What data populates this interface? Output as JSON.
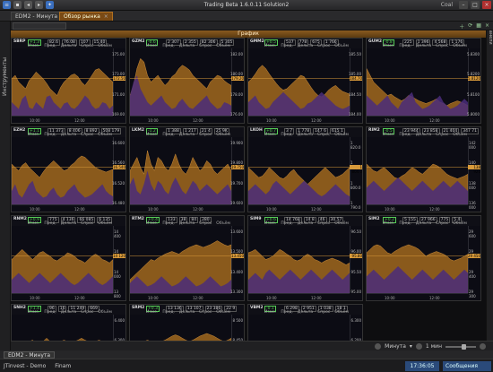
{
  "app": {
    "title": "Trading Beta 1.6.0.11 Solution2",
    "user": "Coal"
  },
  "tabs": [
    {
      "label": "EDM2 - Минута"
    },
    {
      "label": "Обзор рынка"
    }
  ],
  "strips": {
    "left": "Инструменты",
    "right": "Панели"
  },
  "section_header": "График",
  "colors": {
    "accent": "#d89a3a",
    "fill_orange": "#8a5a1c",
    "fill_purple": "#4a2d7a",
    "bg": "#0c0c14"
  },
  "panels": [
    {
      "ticker": "SBRP",
      "chg": "+1.3",
      "cells": [
        "82.6",
        "76.08",
        "107",
        "15.40"
      ],
      "yticks": [
        "175.00",
        "173.00",
        "171.00",
        "169.00"
      ],
      "cur": "172.50",
      "xticks": [
        "10:00",
        "12:00"
      ],
      "bars": [
        0.55,
        0.6,
        0.5,
        0.45,
        0.4,
        0.52,
        0.58,
        0.65,
        0.6,
        0.55,
        0.48,
        0.4,
        0.35,
        0.3,
        0.42,
        0.5,
        0.55,
        0.6,
        0.62,
        0.58,
        0.5,
        0.45,
        0.52,
        0.6,
        0.68,
        0.7,
        0.65,
        0.6,
        0.55,
        0.5
      ],
      "vol": [
        0.2,
        0.15,
        0.1,
        0.25,
        0.3,
        0.12,
        0.1,
        0.2,
        0.15,
        0.1,
        0.28,
        0.3,
        0.2,
        0.15,
        0.1,
        0.18,
        0.2,
        0.12,
        0.1,
        0.15,
        0.22,
        0.3,
        0.25,
        0.15,
        0.1,
        0.12,
        0.2,
        0.18,
        0.1,
        0.15
      ]
    },
    {
      "ticker": "GZM2",
      "chg": "-0.6",
      "cells": [
        "2 307",
        "2 355",
        "82 306",
        "5 305"
      ],
      "yticks": [
        "182.00",
        "180.00",
        "178.00",
        "176.00"
      ],
      "cur": "179.20",
      "xticks": [
        "10:00",
        "12:00"
      ],
      "bars": [
        0.3,
        0.45,
        0.7,
        0.85,
        0.8,
        0.6,
        0.5,
        0.55,
        0.6,
        0.52,
        0.45,
        0.5,
        0.58,
        0.62,
        0.7,
        0.75,
        0.72,
        0.68,
        0.6,
        0.55,
        0.5,
        0.45,
        0.4,
        0.5,
        0.55,
        0.6,
        0.58,
        0.52,
        0.48,
        0.45
      ],
      "vol": [
        0.3,
        0.5,
        0.6,
        0.4,
        0.3,
        0.2,
        0.15,
        0.2,
        0.25,
        0.3,
        0.2,
        0.15,
        0.1,
        0.12,
        0.2,
        0.25,
        0.18,
        0.12,
        0.1,
        0.15,
        0.2,
        0.25,
        0.3,
        0.2,
        0.15,
        0.1,
        0.12,
        0.2,
        0.18,
        0.15
      ]
    },
    {
      "ticker": "GMM2",
      "chg": "+0.5",
      "cells": [
        "537",
        "778",
        "675",
        "1 766"
      ],
      "yticks": [
        "185.50",
        "185.00",
        "184.50",
        "184.00"
      ],
      "cur": "184.70",
      "xticks": [
        "10:00",
        "12:00"
      ],
      "bars": [
        0.5,
        0.55,
        0.62,
        0.7,
        0.75,
        0.7,
        0.62,
        0.55,
        0.48,
        0.42,
        0.38,
        0.4,
        0.45,
        0.5,
        0.55,
        0.6,
        0.58,
        0.5,
        0.42,
        0.35,
        0.3,
        0.28,
        0.32,
        0.38,
        0.42,
        0.45,
        0.4,
        0.36,
        0.34,
        0.32
      ],
      "vol": [
        0.2,
        0.25,
        0.3,
        0.2,
        0.15,
        0.1,
        0.12,
        0.2,
        0.25,
        0.3,
        0.35,
        0.3,
        0.25,
        0.2,
        0.15,
        0.1,
        0.12,
        0.18,
        0.2,
        0.25,
        0.3,
        0.35,
        0.3,
        0.25,
        0.2,
        0.15,
        0.12,
        0.1,
        0.12,
        0.15
      ]
    },
    {
      "ticker": "GUM2",
      "chg": "-0.8",
      "cells": [
        "225",
        "1 396",
        "4 568",
        "1 176"
      ],
      "yticks": [
        "5.8300",
        "5.8200",
        "5.8100",
        "5.8000"
      ],
      "cur": "5.8120",
      "xticks": [
        "10:00",
        "12:00"
      ],
      "bars": [
        0.7,
        0.6,
        0.5,
        0.45,
        0.4,
        0.35,
        0.3,
        0.32,
        0.28,
        0.25,
        0.22,
        0.25,
        0.3,
        0.28,
        0.25,
        0.22,
        0.2,
        0.18,
        0.2,
        0.22,
        0.25,
        0.2,
        0.18,
        0.15,
        0.18,
        0.2,
        0.22,
        0.2,
        0.18,
        0.15
      ],
      "vol": [
        0.3,
        0.25,
        0.2,
        0.15,
        0.2,
        0.25,
        0.3,
        0.2,
        0.15,
        0.1,
        0.2,
        0.25,
        0.3,
        0.35,
        0.2,
        0.15,
        0.1,
        0.12,
        0.15,
        0.2,
        0.25,
        0.3,
        0.2,
        0.15,
        0.1,
        0.12,
        0.15,
        0.2,
        0.25,
        0.2
      ]
    },
    {
      "ticker": "EZH2",
      "chg": "+1.1",
      "cells": [
        "11 373",
        "8 406",
        "8 892",
        "508 179"
      ],
      "yticks": [
        "16.600",
        "16.560",
        "16.520",
        "16.480"
      ],
      "cur": "16.540",
      "xticks": [
        "10:00",
        "12:00"
      ],
      "bars": [
        0.6,
        0.55,
        0.5,
        0.58,
        0.62,
        0.55,
        0.5,
        0.45,
        0.4,
        0.48,
        0.55,
        0.6,
        0.65,
        0.6,
        0.55,
        0.5,
        0.52,
        0.58,
        0.62,
        0.68,
        0.72,
        0.7,
        0.65,
        0.6,
        0.55,
        0.52,
        0.5,
        0.48,
        0.5,
        0.52
      ],
      "vol": [
        0.2,
        0.3,
        0.15,
        0.1,
        0.2,
        0.3,
        0.35,
        0.2,
        0.15,
        0.1,
        0.12,
        0.2,
        0.25,
        0.15,
        0.1,
        0.12,
        0.2,
        0.25,
        0.3,
        0.2,
        0.15,
        0.1,
        0.12,
        0.15,
        0.2,
        0.25,
        0.3,
        0.2,
        0.15,
        0.12
      ]
    },
    {
      "ticker": "LKM2",
      "chg": "-1.2",
      "cells": [
        "1 388",
        "1 217",
        "21 4",
        "25 9K"
      ],
      "yticks": [
        "19.900",
        "19.800",
        "19.700",
        "19.600"
      ],
      "cur": "19.750",
      "xticks": [
        "10:00",
        "12:00"
      ],
      "bars": [
        0.5,
        0.6,
        0.7,
        0.55,
        0.45,
        0.8,
        0.6,
        0.5,
        0.7,
        0.65,
        0.55,
        0.5,
        0.6,
        0.75,
        0.6,
        0.5,
        0.45,
        0.55,
        0.7,
        0.6,
        0.5,
        0.55,
        0.65,
        0.6,
        0.5,
        0.45,
        0.5,
        0.55,
        0.6,
        0.5
      ],
      "vol": [
        0.3,
        0.4,
        0.2,
        0.15,
        0.3,
        0.5,
        0.3,
        0.2,
        0.35,
        0.3,
        0.2,
        0.15,
        0.3,
        0.4,
        0.3,
        0.2,
        0.15,
        0.25,
        0.35,
        0.3,
        0.2,
        0.25,
        0.3,
        0.25,
        0.2,
        0.15,
        0.2,
        0.25,
        0.3,
        0.2
      ]
    },
    {
      "ticker": "LKOH",
      "chg": "+0.7",
      "cells": [
        "3 7",
        "1 778",
        "147 6",
        "615 1"
      ],
      "yticks": [
        "1 820.0",
        "1 810.0",
        "1 800.0",
        "1 790.0"
      ],
      "cur": "1 804.0",
      "xticks": [
        "10:00",
        "12:00"
      ],
      "bars": [
        0.55,
        0.5,
        0.45,
        0.4,
        0.42,
        0.48,
        0.55,
        0.5,
        0.45,
        0.4,
        0.38,
        0.42,
        0.48,
        0.52,
        0.45,
        0.4,
        0.35,
        0.3,
        0.35,
        0.4,
        0.45,
        0.5,
        0.55,
        0.5,
        0.45,
        0.4,
        0.42,
        0.45,
        0.5,
        0.55
      ],
      "vol": [
        0.2,
        0.25,
        0.3,
        0.25,
        0.2,
        0.15,
        0.2,
        0.3,
        0.35,
        0.3,
        0.25,
        0.2,
        0.15,
        0.2,
        0.25,
        0.3,
        0.35,
        0.3,
        0.25,
        0.2,
        0.15,
        0.12,
        0.15,
        0.2,
        0.25,
        0.3,
        0.25,
        0.2,
        0.15,
        0.12
      ]
    },
    {
      "ticker": "RIM2",
      "chg": "-0.5",
      "cells": [
        "23 944",
        "23 858",
        "21 404",
        "347 71"
      ],
      "yticks": [
        "142 000",
        "140 000",
        "138 000",
        "136 000"
      ],
      "cur": "138 920",
      "xticks": [
        "10:00",
        "12:00"
      ],
      "bars": [
        0.6,
        0.55,
        0.5,
        0.48,
        0.52,
        0.55,
        0.5,
        0.45,
        0.4,
        0.38,
        0.42,
        0.45,
        0.5,
        0.55,
        0.52,
        0.48,
        0.45,
        0.5,
        0.55,
        0.6,
        0.58,
        0.55,
        0.5,
        0.45,
        0.42,
        0.4,
        0.38,
        0.4,
        0.42,
        0.45
      ],
      "vol": [
        0.25,
        0.3,
        0.35,
        0.3,
        0.25,
        0.2,
        0.25,
        0.3,
        0.35,
        0.4,
        0.35,
        0.3,
        0.25,
        0.2,
        0.25,
        0.3,
        0.35,
        0.3,
        0.25,
        0.2,
        0.25,
        0.3,
        0.35,
        0.3,
        0.25,
        0.3,
        0.35,
        0.3,
        0.25,
        0.2
      ]
    },
    {
      "ticker": "RNM2",
      "chg": "+0.9",
      "cells": [
        "775",
        "4 136",
        "66 085",
        "6 135"
      ],
      "yticks": [
        "14 400",
        "14 200",
        "14 000",
        "13 800"
      ],
      "cur": "14 120",
      "xticks": [
        "10:00",
        "12:00"
      ],
      "bars": [
        0.5,
        0.55,
        0.6,
        0.65,
        0.6,
        0.55,
        0.5,
        0.55,
        0.6,
        0.62,
        0.58,
        0.55,
        0.5,
        0.48,
        0.52,
        0.55,
        0.6,
        0.58,
        0.55,
        0.5,
        0.48,
        0.45,
        0.5,
        0.55,
        0.58,
        0.55,
        0.5,
        0.48,
        0.45,
        0.5
      ],
      "vol": [
        0.2,
        0.25,
        0.3,
        0.25,
        0.2,
        0.15,
        0.2,
        0.25,
        0.3,
        0.25,
        0.2,
        0.15,
        0.2,
        0.25,
        0.3,
        0.25,
        0.2,
        0.15,
        0.12,
        0.15,
        0.2,
        0.25,
        0.3,
        0.25,
        0.2,
        0.15,
        0.12,
        0.15,
        0.2,
        0.25
      ]
    },
    {
      "ticker": "RTM2",
      "chg": "+0.4",
      "cells": [
        "133",
        "38",
        "84",
        "280"
      ],
      "yticks": [
        "13.600",
        "13.500",
        "13.400",
        "13.300"
      ],
      "cur": "13.450",
      "xticks": [
        "10:00",
        "12:00"
      ],
      "bars": [
        0.2,
        0.25,
        0.3,
        0.35,
        0.4,
        0.45,
        0.5,
        0.48,
        0.52,
        0.55,
        0.58,
        0.6,
        0.62,
        0.6,
        0.58,
        0.62,
        0.65,
        0.68,
        0.7,
        0.72,
        0.7,
        0.68,
        0.7,
        0.72,
        0.75,
        0.78,
        0.75,
        0.72,
        0.7,
        0.72
      ],
      "vol": [
        0.15,
        0.2,
        0.25,
        0.2,
        0.15,
        0.1,
        0.12,
        0.15,
        0.2,
        0.25,
        0.2,
        0.15,
        0.1,
        0.12,
        0.15,
        0.2,
        0.25,
        0.2,
        0.15,
        0.1,
        0.12,
        0.15,
        0.2,
        0.25,
        0.2,
        0.15,
        0.1,
        0.12,
        0.15,
        0.2
      ]
    },
    {
      "ticker": "SIM9",
      "chg": "+0.6",
      "cells": [
        "14 768",
        "14 8",
        "46",
        "30 57"
      ],
      "yticks": [
        "96.50",
        "96.00",
        "95.50",
        "95.00"
      ],
      "cur": "95.80",
      "xticks": [
        "10:00",
        "12:00"
      ],
      "bars": [
        0.6,
        0.62,
        0.65,
        0.6,
        0.55,
        0.5,
        0.52,
        0.55,
        0.6,
        0.65,
        0.62,
        0.58,
        0.55,
        0.5,
        0.48,
        0.5,
        0.55,
        0.58,
        0.55,
        0.5,
        0.48,
        0.45,
        0.48,
        0.5,
        0.52,
        0.5,
        0.48,
        0.45,
        0.42,
        0.45
      ],
      "vol": [
        0.2,
        0.25,
        0.3,
        0.25,
        0.2,
        0.3,
        0.35,
        0.3,
        0.25,
        0.2,
        0.25,
        0.3,
        0.35,
        0.3,
        0.25,
        0.2,
        0.25,
        0.3,
        0.35,
        0.3,
        0.25,
        0.2,
        0.25,
        0.3,
        0.35,
        0.3,
        0.25,
        0.2,
        0.25,
        0.3
      ]
    },
    {
      "ticker": "SIM2",
      "chg": "+0.2",
      "cells": [
        "5 155",
        "27 966",
        "775",
        "5 4"
      ],
      "yticks": [
        "29 600",
        "29 500",
        "29 400",
        "29 300"
      ],
      "cur": "29 450",
      "xticks": [
        "10:00",
        "12:00"
      ],
      "bars": [
        0.6,
        0.65,
        0.7,
        0.72,
        0.7,
        0.65,
        0.6,
        0.58,
        0.62,
        0.65,
        0.68,
        0.7,
        0.72,
        0.7,
        0.68,
        0.65,
        0.6,
        0.55,
        0.58,
        0.6,
        0.62,
        0.6,
        0.58,
        0.55,
        0.5,
        0.48,
        0.5,
        0.52,
        0.55,
        0.58
      ],
      "vol": [
        0.25,
        0.3,
        0.35,
        0.3,
        0.25,
        0.2,
        0.25,
        0.3,
        0.35,
        0.4,
        0.35,
        0.3,
        0.25,
        0.2,
        0.25,
        0.3,
        0.35,
        0.3,
        0.25,
        0.2,
        0.25,
        0.3,
        0.35,
        0.3,
        0.25,
        0.2,
        0.25,
        0.3,
        0.35,
        0.3
      ]
    },
    {
      "ticker": "SNH2",
      "chg": "+1.4",
      "cells": [
        "96",
        "16",
        "11 249",
        "669"
      ],
      "yticks": [
        "6.400",
        "6.300",
        "6.200",
        "6.100"
      ],
      "cur": "6.250",
      "xticks": [
        "10:00",
        "12:00"
      ],
      "bars": [
        0.5,
        0.55,
        0.6,
        0.58,
        0.55,
        0.6,
        0.62,
        0.58,
        0.55,
        0.6,
        0.65,
        0.6,
        0.55,
        0.58,
        0.6,
        0.62,
        0.6,
        0.58,
        0.6,
        0.62,
        0.65,
        0.62,
        0.6,
        0.58,
        0.6,
        0.62,
        0.6,
        0.58,
        0.55,
        0.6
      ],
      "vol": [
        0.2,
        0.25,
        0.2,
        0.15,
        0.2,
        0.25,
        0.3,
        0.25,
        0.2,
        0.15,
        0.2,
        0.25,
        0.3,
        0.25,
        0.2,
        0.15,
        0.2,
        0.25,
        0.3,
        0.25,
        0.2,
        0.15,
        0.2,
        0.25,
        0.3,
        0.25,
        0.2,
        0.15,
        0.2,
        0.25
      ]
    },
    {
      "ticker": "SRM2",
      "chg": "+0.3",
      "cells": [
        "13 136",
        "13 107",
        "23 386",
        "22 9"
      ],
      "yticks": [
        "8 500",
        "8 450",
        "8 400",
        "8 350"
      ],
      "cur": "8 420",
      "xticks": [
        "10:00",
        "12:00"
      ],
      "bars": [
        0.45,
        0.5,
        0.55,
        0.58,
        0.6,
        0.62,
        0.6,
        0.58,
        0.55,
        0.6,
        0.62,
        0.65,
        0.68,
        0.7,
        0.68,
        0.65,
        0.62,
        0.6,
        0.62,
        0.65,
        0.68,
        0.7,
        0.72,
        0.7,
        0.68,
        0.65,
        0.62,
        0.6,
        0.62,
        0.65
      ],
      "vol": [
        0.2,
        0.25,
        0.3,
        0.25,
        0.2,
        0.15,
        0.2,
        0.25,
        0.3,
        0.25,
        0.2,
        0.15,
        0.2,
        0.25,
        0.3,
        0.25,
        0.2,
        0.15,
        0.2,
        0.25,
        0.3,
        0.25,
        0.2,
        0.15,
        0.2,
        0.25,
        0.3,
        0.25,
        0.2,
        0.15
      ]
    },
    {
      "ticker": "VBM2",
      "chg": "-0.1",
      "cells": [
        "6 298",
        "2 951",
        "1 038",
        "18 1"
      ],
      "yticks": [
        "6.300",
        "6.200",
        "6.100",
        "6.000"
      ],
      "cur": "6.150",
      "xticks": [
        "10:00",
        "12:00"
      ],
      "bars": [
        0.5,
        0.48,
        0.45,
        0.5,
        0.52,
        0.55,
        0.5,
        0.48,
        0.45,
        0.42,
        0.45,
        0.48,
        0.5,
        0.52,
        0.5,
        0.48,
        0.45,
        0.42,
        0.4,
        0.42,
        0.45,
        0.48,
        0.5,
        0.48,
        0.45,
        0.42,
        0.4,
        0.42,
        0.45,
        0.48
      ],
      "vol": [
        0.2,
        0.25,
        0.3,
        0.25,
        0.2,
        0.15,
        0.2,
        0.25,
        0.3,
        0.25,
        0.2,
        0.15,
        0.2,
        0.25,
        0.3,
        0.25,
        0.2,
        0.15,
        0.2,
        0.25,
        0.3,
        0.25,
        0.2,
        0.15,
        0.2,
        0.25,
        0.3,
        0.25,
        0.2,
        0.15
      ]
    }
  ],
  "panel_labels": [
    "Изме.",
    "Пред.",
    "Дельта",
    "Спрос",
    "Объём"
  ],
  "bottom_toolbar": {
    "interval": "Минута",
    "zoom": "1 мин"
  },
  "bottom_tab": "EDM2 - Минута",
  "status": {
    "left1": "JTinvest - Demo",
    "left2": "Finam",
    "clock": "17:36:05",
    "messages": "Сообщения"
  }
}
